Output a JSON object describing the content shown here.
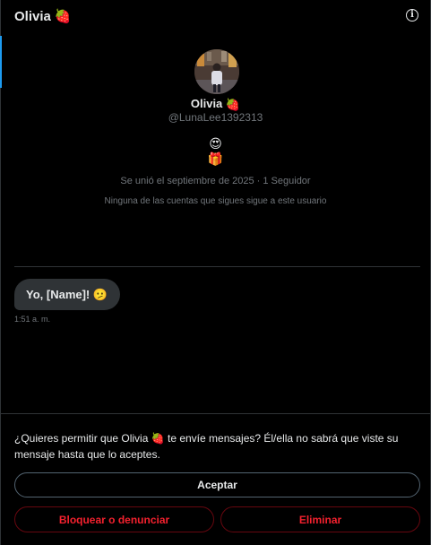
{
  "header": {
    "title": "Olivia",
    "title_emoji": "🍓",
    "info_icon": "info-icon"
  },
  "profile": {
    "name": "Olivia",
    "name_emoji": "🍓",
    "handle": "@LunaLee1392313",
    "bio_line_1": "😍",
    "bio_line_2": "🎁",
    "joined": "Se unió el septiembre de 2025 · 1 Seguidor",
    "followers_note": "Ninguna de las cuentas que sigues sigue a este usuario"
  },
  "messages": [
    {
      "text": "Yo, [Name]! 🫤",
      "time": "1:51 a. m."
    }
  ],
  "request": {
    "text": "¿Quieres permitir que Olivia 🍓 te envíe mensajes? Él/ella no sabrá que viste su mensaje hasta que lo aceptes.",
    "accept_label": "Aceptar",
    "block_label": "Bloquear o denunciar",
    "delete_label": "Eliminar"
  },
  "colors": {
    "background": "#000000",
    "text": "#e7e9ea",
    "muted": "#71767b",
    "bubble": "#2f3336",
    "danger": "#f4212e",
    "accent": "#1d9bf0"
  }
}
